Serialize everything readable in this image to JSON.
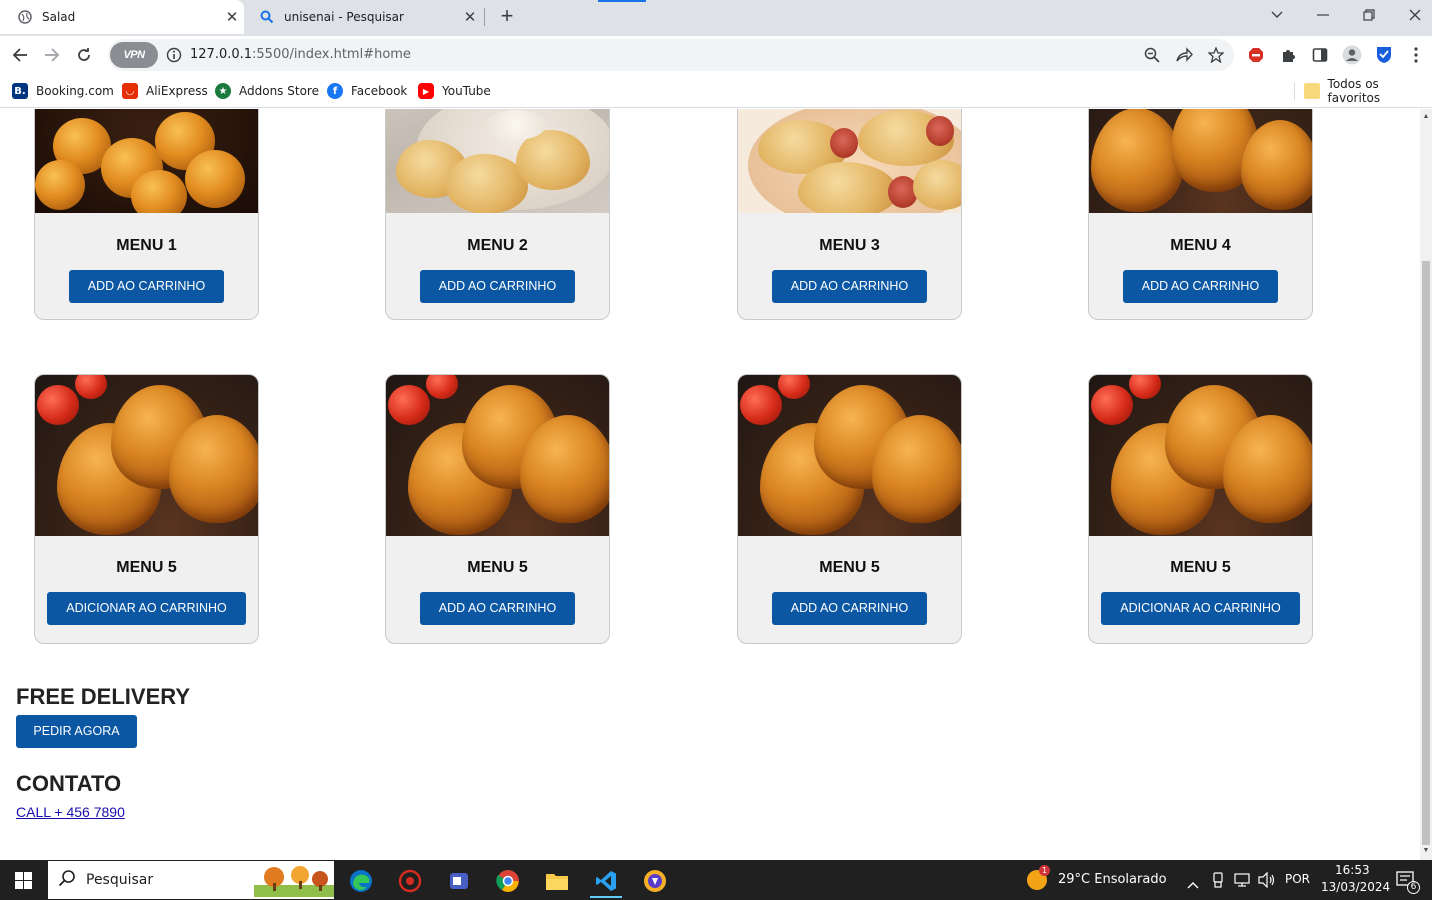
{
  "browser": {
    "tabs": [
      {
        "title": "Salad",
        "active": true
      },
      {
        "title": "unisenai - Pesquisar",
        "active": false
      }
    ],
    "url": {
      "host": "127.0.0.1",
      "rest": ":5500/index.html#home"
    },
    "vpn_label": "VPN",
    "bookmarks": [
      {
        "label": "Booking.com",
        "icon": "booking-icon"
      },
      {
        "label": "AliExpress",
        "icon": "aliexpress-icon"
      },
      {
        "label": "Addons Store",
        "icon": "addons-store-icon"
      },
      {
        "label": "Facebook",
        "icon": "facebook-icon"
      },
      {
        "label": "YouTube",
        "icon": "youtube-icon"
      }
    ],
    "all_bookmarks": "Todos os favoritos"
  },
  "menu": {
    "row1": [
      {
        "name": "MENU 1",
        "button": "ADD AO CARRINHO",
        "image": "bolinhas-de-queijo"
      },
      {
        "name": "MENU 2",
        "button": "ADD AO CARRINHO",
        "image": "pasteis-prato"
      },
      {
        "name": "MENU 3",
        "button": "ADD AO CARRINHO",
        "image": "enroladinho-salsicha"
      },
      {
        "name": "MENU 4",
        "button": "ADD AO CARRINHO",
        "image": "coxinhas"
      }
    ],
    "row2": [
      {
        "name": "MENU 5",
        "button": "ADICIONAR AO CARRINHO",
        "image": "coxinhas"
      },
      {
        "name": "MENU 5",
        "button": "ADD AO CARRINHO",
        "image": "coxinhas"
      },
      {
        "name": "MENU 5",
        "button": "ADD AO CARRINHO",
        "image": "coxinhas"
      },
      {
        "name": "MENU 5",
        "button": "ADICIONAR AO CARRINHO",
        "image": "coxinhas"
      }
    ]
  },
  "delivery": {
    "title": "FREE DELIVERY",
    "button": "PEDIR AGORA"
  },
  "contact": {
    "title": "CONTATO",
    "phone": "CALL + 456 7890"
  },
  "taskbar": {
    "search_placeholder": "Pesquisar",
    "weather": "29°C  Ensolarado",
    "weather_badge": "1",
    "language": "POR",
    "time": "16:53",
    "date": "13/03/2024",
    "notifications": "6"
  }
}
